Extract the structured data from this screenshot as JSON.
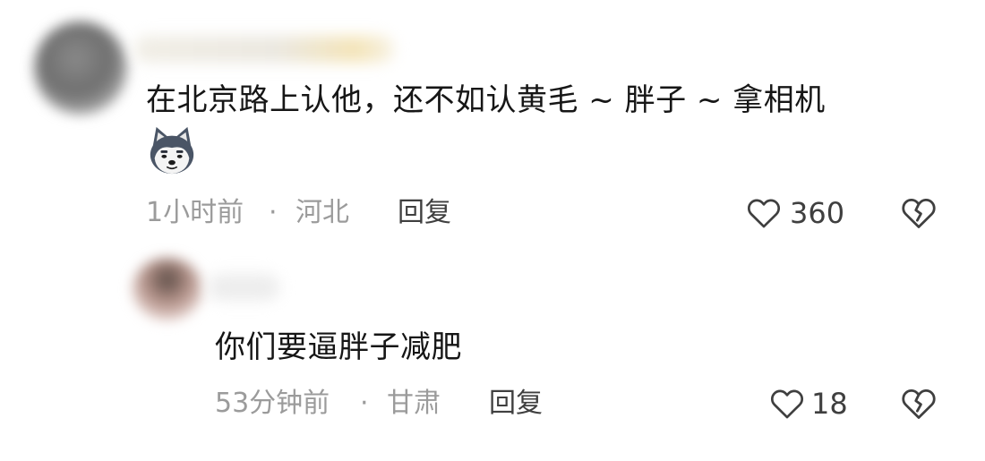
{
  "comments": [
    {
      "text": "在北京路上认他，还不如认黄毛 ~ 胖子 ~ 拿相机",
      "sticker": "husky-dog-emoji",
      "time": "1小时前",
      "separator": "·",
      "location": "河北",
      "reply_label": "回复",
      "likes": "360"
    },
    {
      "text": "你们要逼胖子减肥",
      "time": "53分钟前",
      "separator": "·",
      "location": "甘肃",
      "reply_label": "回复",
      "likes": "18"
    }
  ],
  "icons": {
    "like": "heart-outline-icon",
    "dislike": "broken-heart-icon"
  },
  "colors": {
    "text_primary": "#161616",
    "text_meta": "#9b9b9b",
    "text_action": "#3f3f3f",
    "background": "#ffffff"
  }
}
